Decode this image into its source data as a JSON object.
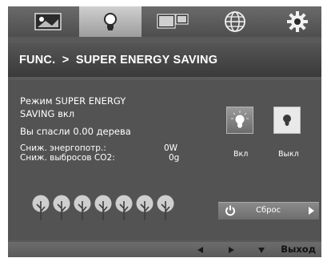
{
  "tabs": [
    {
      "name": "picture",
      "icon": "picture-adjust-icon",
      "active": false
    },
    {
      "name": "energy",
      "icon": "lightbulb-icon",
      "active": true
    },
    {
      "name": "pip",
      "icon": "multi-screen-icon",
      "active": false
    },
    {
      "name": "globe",
      "icon": "globe-icon",
      "active": false
    },
    {
      "name": "settings",
      "icon": "gear-icon",
      "active": false
    }
  ],
  "header": {
    "title": "FUNC.  >  SUPER ENERGY SAVING"
  },
  "status": {
    "mode_line1": "Режим SUPER ENERGY",
    "mode_line2": "SAVING вкл",
    "saved_trees": "Вы спасли 0.00 дерева",
    "energy_label": "Сниж. энергопотр.:",
    "energy_value": "0W",
    "co2_label": "Сниж. выбросов CO2:",
    "co2_value": "0g"
  },
  "options": {
    "on_label": "Вкл",
    "off_label": "Выкл",
    "selected": "on"
  },
  "trees": {
    "count": 7,
    "icon": "tree-icon"
  },
  "reset": {
    "label": "Сброс",
    "icon": "power-icon",
    "arrow_icon": "triangle-right-icon"
  },
  "footer": {
    "left_icon": "triangle-left-icon",
    "right_icon": "triangle-right-icon",
    "down_icon": "triangle-down-icon",
    "exit_label": "Выход"
  },
  "colors": {
    "panel": "#5a5a5a",
    "header": "#3a3a3a",
    "active_tab": "#bdbdbd",
    "text": "#ffffff"
  }
}
